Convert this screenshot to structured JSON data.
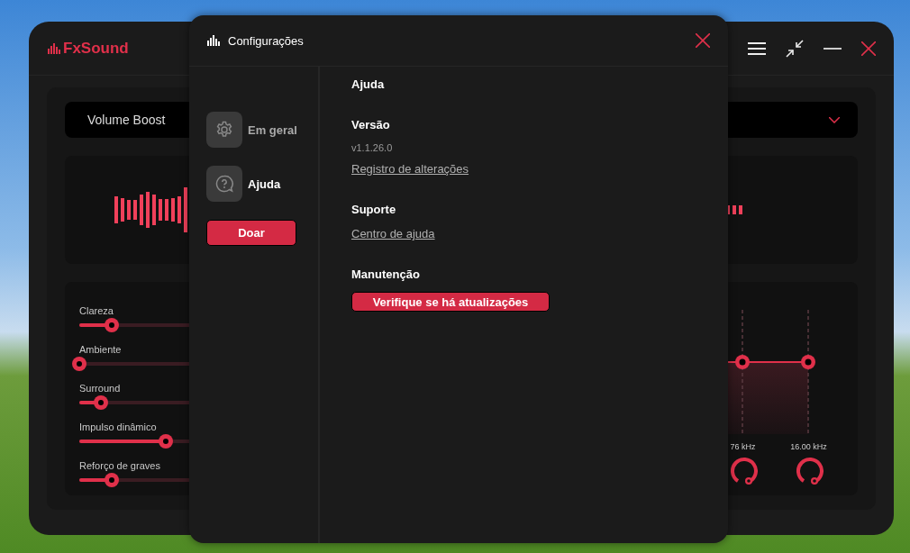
{
  "main_window": {
    "app_name": "FxSound",
    "preset": {
      "value": "Volume Boost"
    },
    "effects": [
      {
        "label": "Clareza",
        "level": 0.12
      },
      {
        "label": "Ambiente",
        "level": 0
      },
      {
        "label": "Surround",
        "level": 0.08
      },
      {
        "label": "Impulso dinâmico",
        "level": 0.32
      },
      {
        "label": "Reforço de graves",
        "level": 0.12
      }
    ],
    "eq_bands": [
      {
        "frequency": "76 kHz"
      },
      {
        "frequency": "16.00 kHz"
      }
    ]
  },
  "settings_dialog": {
    "title": "Configurações",
    "nav": [
      {
        "label": "Em geral",
        "selected": false
      },
      {
        "label": "Ajuda",
        "selected": true
      }
    ],
    "donate_button": "Doar",
    "heading": "Ajuda",
    "sections": [
      {
        "title": "Versão",
        "items": [
          {
            "kind": "text",
            "text": "v1.1.26.0"
          },
          {
            "kind": "link",
            "text": "Registro de alterações"
          }
        ]
      },
      {
        "title": "Suporte",
        "items": [
          {
            "kind": "link",
            "text": "Centro de ajuda"
          }
        ]
      },
      {
        "title": "Manutenção",
        "items": [
          {
            "kind": "button",
            "text": "Verifique se há atualizações"
          }
        ]
      }
    ]
  }
}
